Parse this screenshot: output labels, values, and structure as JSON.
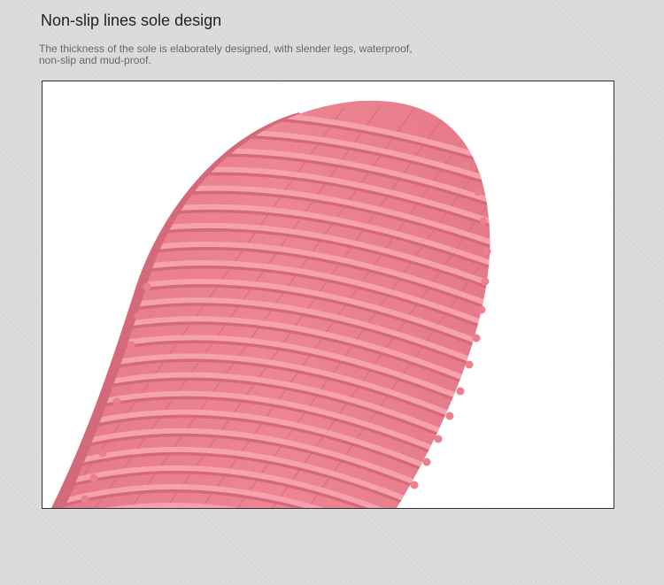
{
  "section": {
    "title": "Non-slip lines sole design",
    "description_line1": "The thickness of the sole is elaborately designed, with slender legs, waterproof,",
    "description_line2": "non-slip and mud-proof."
  },
  "colors": {
    "page_bg": "#d9d9d9",
    "sole_pink": "#ee8593",
    "sole_ridge": "#f6a2ad",
    "sole_shadow": "#d46a79"
  }
}
